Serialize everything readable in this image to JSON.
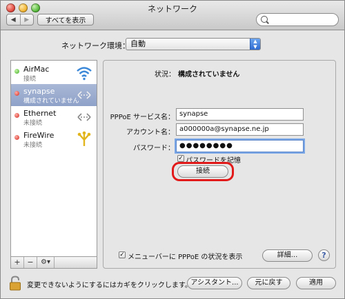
{
  "window": {
    "title": "ネットワーク"
  },
  "toolbar": {
    "back": "◀",
    "forward": "▶",
    "show_all": "すべてを表示",
    "search_placeholder": ""
  },
  "location": {
    "label": "ネットワーク環境：",
    "value": "自動"
  },
  "services": [
    {
      "name": "AirMac",
      "status": "接続",
      "status_color": "green",
      "icon": "wifi-icon"
    },
    {
      "name": "synapse",
      "status": "構成されていません",
      "status_color": "red",
      "icon": "ppp-icon",
      "selected": true
    },
    {
      "name": "Ethernet",
      "status": "未接続",
      "status_color": "red",
      "icon": "ethernet-icon"
    },
    {
      "name": "FireWire",
      "status": "未接続",
      "status_color": "red",
      "icon": "firewire-icon"
    }
  ],
  "list_toolbar": {
    "add": "+",
    "remove": "−",
    "gear": "⚙▾"
  },
  "detail": {
    "status_label": "状況：",
    "status_value": "構成されていません",
    "service_name_label": "PPPoE サービス名：",
    "service_name_value": "synapse",
    "account_label": "アカウント名：",
    "account_value": "a000000a@synapse.ne.jp",
    "password_label": "パスワード：",
    "password_value": "●●●●●●●●",
    "remember_password": "パスワードを記憶",
    "connect_button": "接続",
    "show_in_menubar": "メニューバーに PPPoE の状況を表示",
    "advanced_button": "詳細...",
    "help": "?"
  },
  "footer": {
    "lock_text": "変更できないようにするにはカギをクリックします。",
    "assistant_button": "アシスタント...",
    "revert_button": "元に戻す",
    "apply_button": "適用"
  },
  "colors": {
    "selection": "#9aabd0",
    "highlight_ring": "#e21a1a",
    "focus": "#7ba7e6"
  }
}
